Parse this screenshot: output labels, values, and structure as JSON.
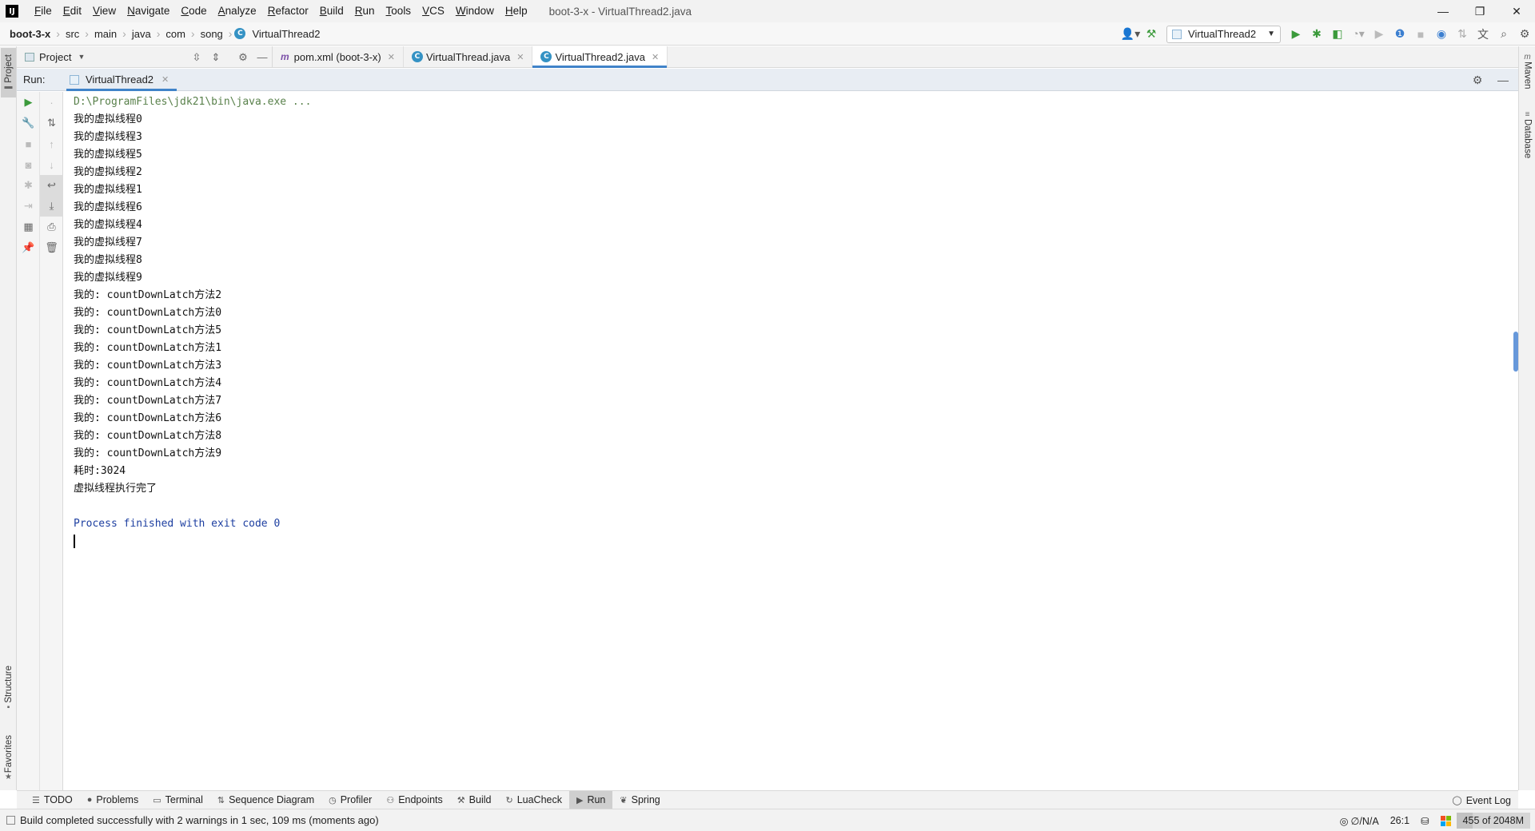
{
  "window": {
    "title": "boot-3-x - VirtualThread2.java",
    "minimize": "—",
    "restore": "❐",
    "close": "✕"
  },
  "menu": [
    "File",
    "Edit",
    "View",
    "Navigate",
    "Code",
    "Analyze",
    "Refactor",
    "Build",
    "Run",
    "Tools",
    "VCS",
    "Window",
    "Help"
  ],
  "breadcrumbs": [
    "boot-3-x",
    "src",
    "main",
    "java",
    "com",
    "song",
    "VirtualThread2"
  ],
  "toolbar": {
    "run_config": "VirtualThread2"
  },
  "project_panel": {
    "label": "Project"
  },
  "editor_tabs": [
    {
      "label": "pom.xml (boot-3-x)",
      "icon": "maven-icon",
      "active": false
    },
    {
      "label": "VirtualThread.java",
      "icon": "class-icon",
      "active": false
    },
    {
      "label": "VirtualThread2.java",
      "icon": "class-icon",
      "active": true
    }
  ],
  "left_stripe": {
    "project": "Project",
    "structure": "Structure",
    "favorites": "Favorites"
  },
  "right_stripe": {
    "maven": "Maven",
    "database": "Database"
  },
  "run_window": {
    "label": "Run:",
    "tab": "VirtualThread2"
  },
  "console": {
    "command": "D:\\ProgramFiles\\jdk21\\bin\\java.exe ...",
    "lines": [
      "我的虚拟线程0",
      "我的虚拟线程3",
      "我的虚拟线程5",
      "我的虚拟线程2",
      "我的虚拟线程1",
      "我的虚拟线程6",
      "我的虚拟线程4",
      "我的虚拟线程7",
      "我的虚拟线程8",
      "我的虚拟线程9",
      "我的: countDownLatch方法2",
      "我的: countDownLatch方法0",
      "我的: countDownLatch方法5",
      "我的: countDownLatch方法1",
      "我的: countDownLatch方法3",
      "我的: countDownLatch方法4",
      "我的: countDownLatch方法7",
      "我的: countDownLatch方法6",
      "我的: countDownLatch方法8",
      "我的: countDownLatch方法9",
      "耗时:3024",
      "虚拟线程执行完了"
    ],
    "finished": "Process finished with exit code 0"
  },
  "bottom_tools": [
    {
      "label": "TODO",
      "icon": "☰"
    },
    {
      "label": "Problems",
      "icon": "●"
    },
    {
      "label": "Terminal",
      "icon": "▭"
    },
    {
      "label": "Sequence Diagram",
      "icon": "⇅"
    },
    {
      "label": "Profiler",
      "icon": "◷"
    },
    {
      "label": "Endpoints",
      "icon": "⚇"
    },
    {
      "label": "Build",
      "icon": "⚒"
    },
    {
      "label": "LuaCheck",
      "icon": "↻"
    },
    {
      "label": "Run",
      "icon": "▶"
    },
    {
      "label": "Spring",
      "icon": "❦"
    }
  ],
  "event_log": "Event Log",
  "status": {
    "message": "Build completed successfully with 2 warnings in 1 sec, 109 ms (moments ago)",
    "vcs": "∅/N/A",
    "position": "26:1",
    "memory": "455 of 2048M",
    "memory_used_fraction": 0.22
  },
  "colors": {
    "accent": "#4083c9",
    "console_command": "#59814b",
    "console_process": "#1c3ea0",
    "run_green": "#3b9a3b"
  }
}
